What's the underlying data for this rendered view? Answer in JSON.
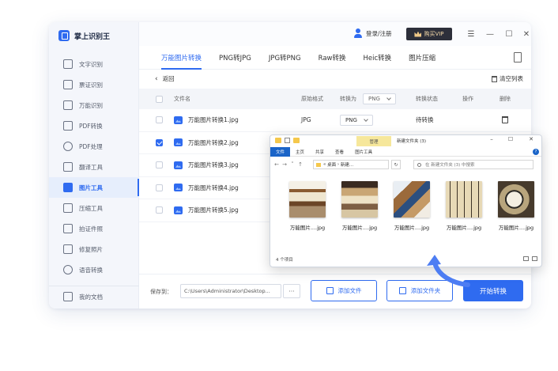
{
  "app": {
    "name": "掌上识别王",
    "login": "登录/注册",
    "buy_vip": "购买VIP"
  },
  "sidebar": {
    "items": [
      {
        "label": "文字识别",
        "icon": "text-scan-icon"
      },
      {
        "label": "票证识别",
        "icon": "ticket-icon"
      },
      {
        "label": "万能识别",
        "icon": "universal-scan-icon"
      },
      {
        "label": "PDF转换",
        "icon": "pdf-convert-icon"
      },
      {
        "label": "PDF处理",
        "icon": "pdf-process-icon"
      },
      {
        "label": "翻译工具",
        "icon": "translate-icon"
      },
      {
        "label": "图片工具",
        "icon": "image-tool-icon",
        "active": true
      },
      {
        "label": "压缩工具",
        "icon": "compress-icon"
      },
      {
        "label": "拍证件照",
        "icon": "id-photo-icon"
      },
      {
        "label": "修复照片",
        "icon": "repair-photo-icon"
      },
      {
        "label": "语音转换",
        "icon": "voice-icon"
      }
    ],
    "bottom": {
      "label": "我的文档",
      "icon": "my-docs-icon"
    }
  },
  "tabs": [
    "万能图片转换",
    "PNG转JPG",
    "JPG转PNG",
    "Raw转换",
    "Heic转换",
    "图片压缩"
  ],
  "toolbar": {
    "back": "返回",
    "clear": "清空列表"
  },
  "table": {
    "headers": {
      "name": "文件名",
      "format": "原始格式",
      "convert_to": "转换为",
      "convert_to_value": "PNG",
      "status": "转换状态",
      "op": "操作",
      "delete": "删除"
    },
    "rows": [
      {
        "name": "万能图片转换1.jpg",
        "format": "JPG",
        "target": "PNG",
        "status": "待转换",
        "checked": false
      },
      {
        "name": "万能图片转换2.jpg",
        "checked": true
      },
      {
        "name": "万能图片转换3.jpg",
        "checked": false
      },
      {
        "name": "万能图片转换4.jpg",
        "checked": false
      },
      {
        "name": "万能图片转换5.jpg",
        "checked": false
      }
    ]
  },
  "bottom": {
    "save_label": "保存到：",
    "save_path": "C:\\Users\\Administrator\\Desktop...",
    "more": "···",
    "add_file": "添加文件",
    "add_folder": "添加文件夹",
    "start": "开始转换"
  },
  "explorer": {
    "manage": "管理",
    "title": "新建文件夹 (3)",
    "ribbon": [
      "文件",
      "主页",
      "共享",
      "查看",
      "图片工具"
    ],
    "path": [
      "«",
      "桌面",
      "›",
      "新建..."
    ],
    "search_placeholder": "在 新建文件夹 (3) 中搜索",
    "thumbs": [
      "万能图片....jpg",
      "万能图片....jpg",
      "万能图片....jpg",
      "万能图片....jpg",
      "万能图片....jpg"
    ],
    "count": "4 个项目"
  },
  "colors": {
    "accent": "#2f6bf0",
    "vip_bg": "#2d2f3a",
    "vip_text": "#f3d8a8"
  }
}
